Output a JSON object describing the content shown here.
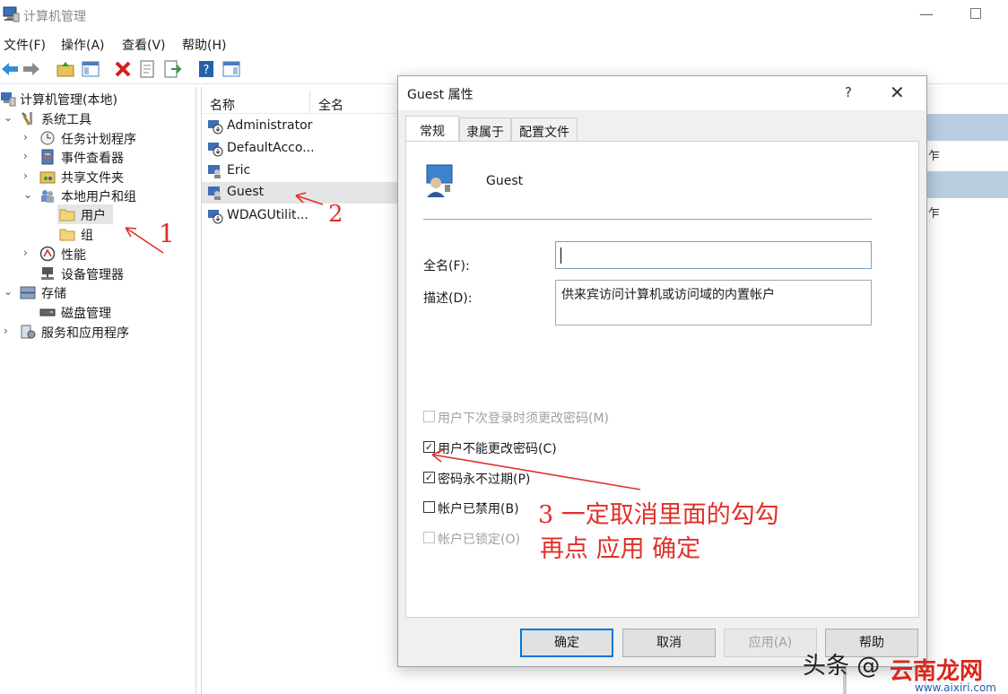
{
  "window": {
    "title": "计算机管理"
  },
  "menu": [
    "文件(F)",
    "操作(A)",
    "查看(V)",
    "帮助(H)"
  ],
  "tree": {
    "root": "计算机管理(本地)",
    "system_tools": "系统工具",
    "task_scheduler": "任务计划程序",
    "event_viewer": "事件查看器",
    "shared_folders": "共享文件夹",
    "local_users_groups": "本地用户和组",
    "users": "用户",
    "groups": "组",
    "performance": "性能",
    "device_manager": "设备管理器",
    "storage": "存储",
    "disk_management": "磁盘管理",
    "services_apps": "服务和应用程序"
  },
  "list": {
    "col_name": "名称",
    "col_fullname": "全名",
    "users": [
      "Administrator",
      "DefaultAcco...",
      "Eric",
      "Guest",
      "WDAGUtilit..."
    ]
  },
  "actions_pane": {
    "frag1": "乍",
    "frag2": "乍"
  },
  "dialog": {
    "title": "Guest 属性",
    "help": "?",
    "close": "✕",
    "tabs": [
      "常规",
      "隶属于",
      "配置文件"
    ],
    "user_name": "Guest",
    "fullname_label": "全名(F):",
    "fullname_value": "",
    "desc_label": "描述(D):",
    "desc_value": "供来宾访问计算机或访问域的内置帐户",
    "checkboxes": [
      {
        "label": "用户下次登录时须更改密码(M)",
        "checked": false,
        "disabled": true
      },
      {
        "label": "用户不能更改密码(C)",
        "checked": true,
        "disabled": false
      },
      {
        "label": "密码永不过期(P)",
        "checked": true,
        "disabled": false
      },
      {
        "label": "帐户已禁用(B)",
        "checked": false,
        "disabled": false
      },
      {
        "label": "帐户已锁定(O)",
        "checked": false,
        "disabled": true
      }
    ],
    "buttons": {
      "ok": "确定",
      "cancel": "取消",
      "apply": "应用(A)",
      "help": "帮助"
    }
  },
  "annotations": {
    "n1": "1",
    "n2": "2",
    "n3_line1": "3 一定取消里面的勾勾",
    "n3_line2": "再点 应用 确定"
  },
  "watermark": {
    "text": "头条 @",
    "logo": "云南龙网",
    "url": "www.aixiri.com"
  },
  "colors": {
    "accent": "#0078d7",
    "annotation": "#e0302a",
    "selection": "#e5e5e5",
    "action_band": "#b8cde0"
  }
}
